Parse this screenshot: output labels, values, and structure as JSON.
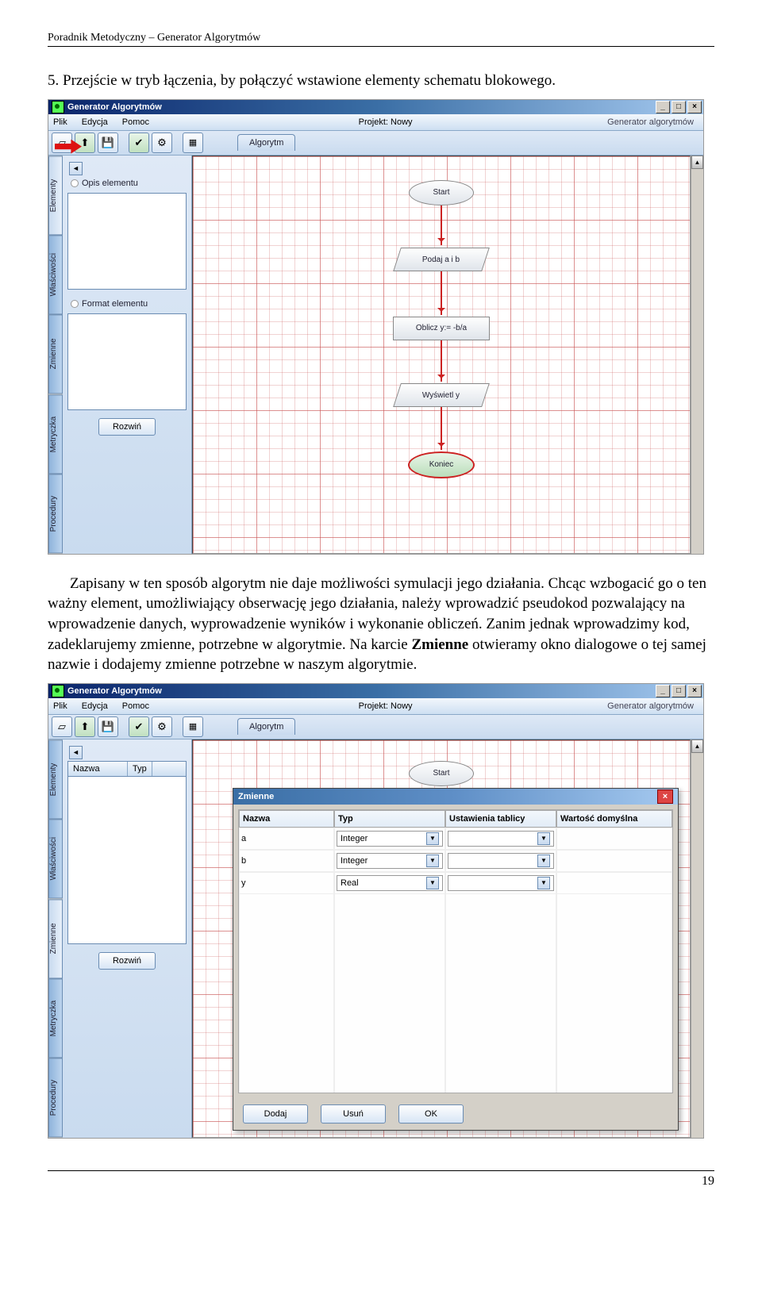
{
  "doc_header": "Poradnik Metodyczny – Generator Algorytmów",
  "para1_num": "5.",
  "para1": " Przejście w tryb łączenia, by połączyć wstawione elementy schematu blokowego.",
  "para2a": "Zapisany w ten sposób algorytm nie daje możliwości symulacji jego działania. Chcąc wzbogacić go o ten ważny element, umożliwiający obserwację jego działania, należy wprowadzić pseudokod pozwalający na wprowadzenie danych, wyprowadzenie wyników i wykonanie obliczeń. Zanim jednak wprowadzimy kod, zadeklarujemy zmienne, potrzebne w algorytmie. Na karcie ",
  "para2b": "Zmienne",
  "para2c": " otwieramy okno dialogowe o tej samej nazwie i dodajemy zmienne potrzebne w naszym algorytmie.",
  "app_title": "Generator Algorytmów",
  "menu": {
    "plik": "Plik",
    "edycja": "Edycja",
    "pomoc": "Pomoc",
    "projekt": "Projekt: Nowy",
    "brand": "Generator algorytmów"
  },
  "tab_alg": "Algorytm",
  "vtabs": [
    "Elementy",
    "Właściwości",
    "Zmienne",
    "Metryczka",
    "Procedury"
  ],
  "left1": {
    "h1": "Opis elementu",
    "h2": "Format elementu",
    "btn": "Rozwiń"
  },
  "left2": {
    "col1": "Nazwa",
    "col2": "Typ",
    "btn": "Rozwiń"
  },
  "flow": {
    "start": "Start",
    "in": "Podaj a i b",
    "calc": "Oblicz y:= -b/a",
    "out": "Wyświetl y",
    "end": "Koniec"
  },
  "dialog": {
    "title": "Zmienne",
    "cols": [
      "Nazwa",
      "Typ",
      "Ustawienia tablicy",
      "Wartość domyślna"
    ],
    "rows": [
      {
        "name": "a",
        "type": "Integer"
      },
      {
        "name": "b",
        "type": "Integer"
      },
      {
        "name": "y",
        "type": "Real"
      }
    ],
    "btns": [
      "Dodaj",
      "Usuń",
      "OK"
    ]
  },
  "page_no": "19"
}
